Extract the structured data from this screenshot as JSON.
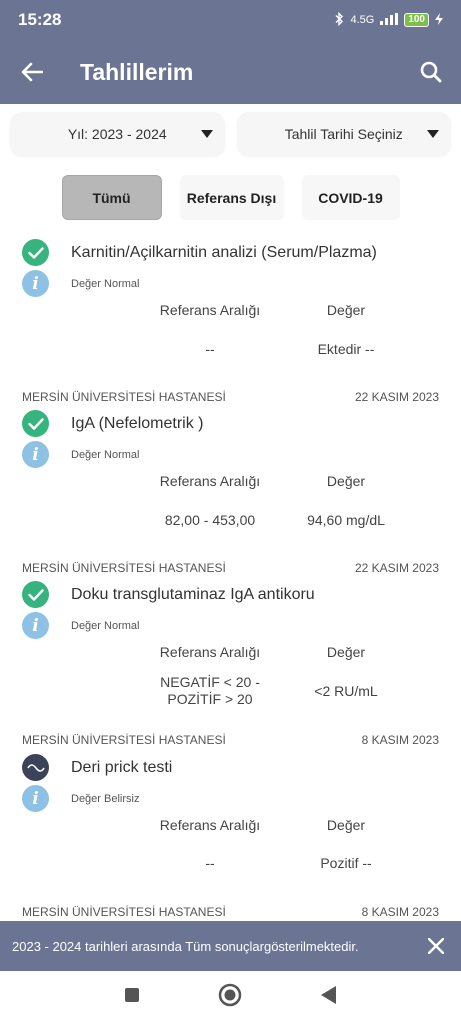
{
  "status_bar": {
    "time": "15:28",
    "network": "4.5G",
    "battery": "100"
  },
  "app_bar": {
    "title": "Tahlillerim"
  },
  "filters": {
    "year": "Yıl: 2023 - 2024",
    "date": "Tahlil Tarihi Seçiniz"
  },
  "tabs": [
    {
      "label": "Tümü",
      "active": true
    },
    {
      "label": "Referans Dışı",
      "active": false
    },
    {
      "label": "COVID-19",
      "active": false
    }
  ],
  "columns": {
    "ref": "Referans Aralığı",
    "value": "Değer"
  },
  "results": [
    {
      "hospital": "",
      "date": "",
      "name": "Karnitin/Açilkarnitin analizi (Serum/Plazma)",
      "status": "Değer Normal",
      "status_icon": "check-icon",
      "ref": "--",
      "value": "Ektedir --"
    },
    {
      "hospital": "MERSİN ÜNİVERSİTESİ HASTANESİ",
      "date": "22 KASIM 2023",
      "name": "IgA (Nefelometrik )",
      "status": "Değer Normal",
      "status_icon": "check-icon",
      "ref": "82,00 - 453,00",
      "value": "94,60 mg/dL"
    },
    {
      "hospital": "MERSİN ÜNİVERSİTESİ HASTANESİ",
      "date": "22 KASIM 2023",
      "name": "Doku transglutaminaz IgA antikoru",
      "status": "Değer Normal",
      "status_icon": "check-icon",
      "ref_line1": "NEGATİF < 20 -",
      "ref_line2": "POZİTİF > 20",
      "value": "<2 RU/mL"
    },
    {
      "hospital": "MERSİN ÜNİVERSİTESİ HASTANESİ",
      "date": "8 KASIM 2023",
      "name": "Deri prick testi",
      "status": "Değer Belirsiz",
      "status_icon": "wave-icon",
      "ref": "--",
      "value": "Pozitif --"
    },
    {
      "hospital": "MERSİN ÜNİVERSİTESİ HASTANESİ",
      "date": "8 KASIM 2023"
    }
  ],
  "banner": {
    "text": "2023 - 2024 tarihleri arasında Tüm sonuçlargösterilmektedir."
  },
  "colors": {
    "primary": "#6b7593",
    "check": "#36b37e",
    "info": "#8ec1e4",
    "wave": "#3c4258"
  }
}
